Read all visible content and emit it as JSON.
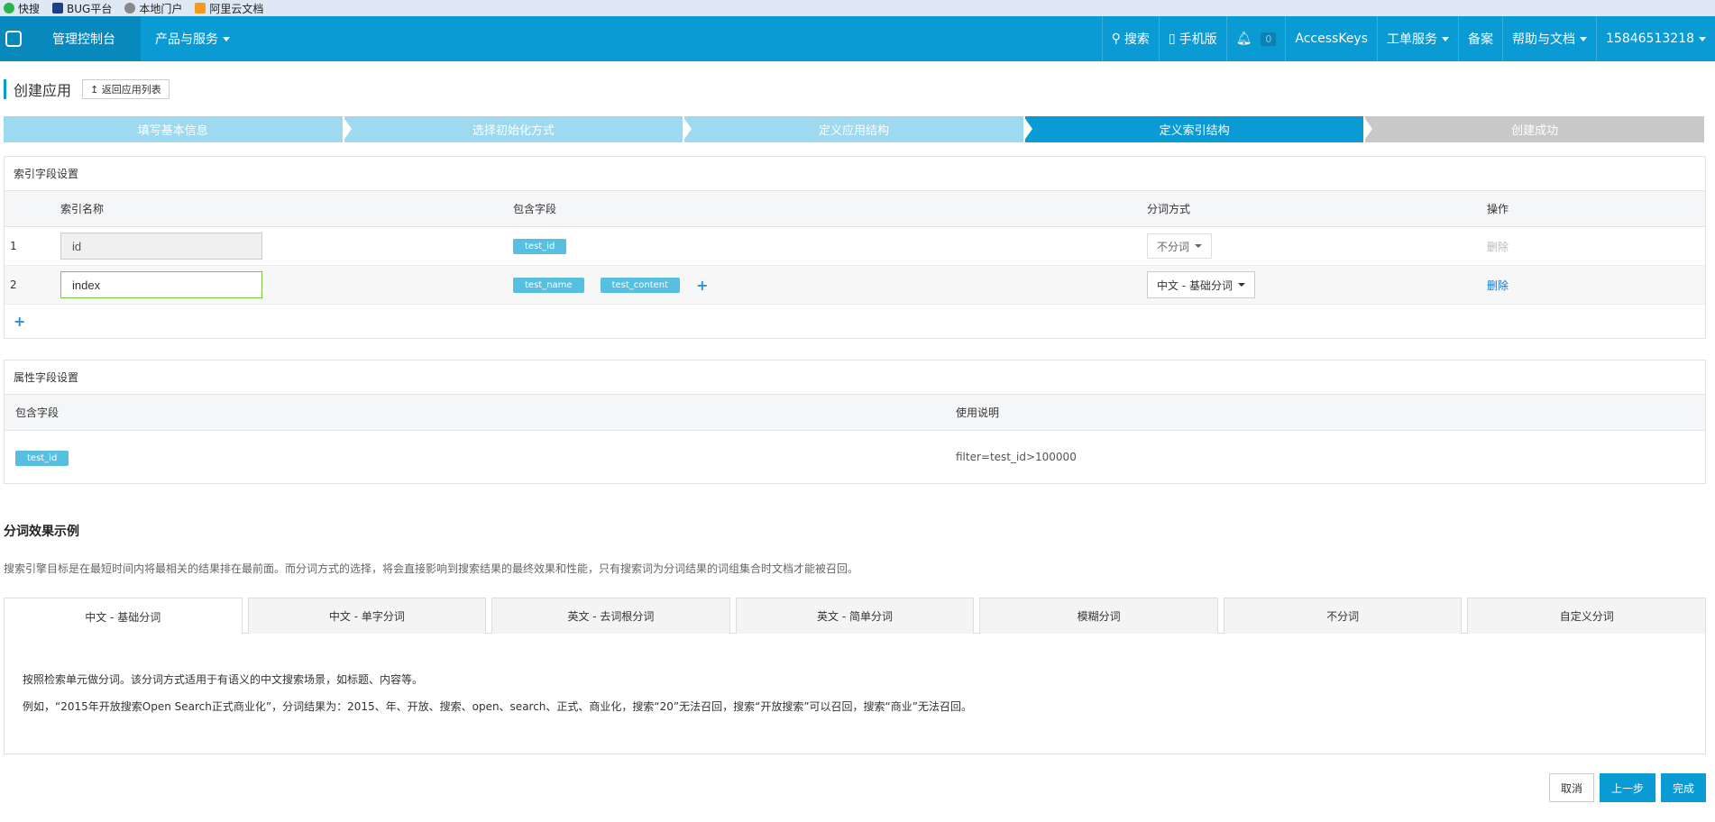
{
  "bookmarks": [
    {
      "label": "快搜",
      "icon": "kuaisou-icon",
      "color": "#2db34a"
    },
    {
      "label": "BUG平台",
      "icon": "bug-icon",
      "color": "#1d3f8a"
    },
    {
      "label": "本地门户",
      "icon": "globe-icon",
      "color": "#888888"
    },
    {
      "label": "阿里云文档",
      "icon": "aliyun-doc-icon",
      "color": "#f39a1f"
    }
  ],
  "nav": {
    "console": "管理控制台",
    "products": "产品与服务",
    "search": "搜索",
    "mobile": "手机版",
    "notify_count": "0",
    "accesskeys": "AccessKeys",
    "tickets": "工单服务",
    "record": "备案",
    "help": "帮助与文档",
    "user": "15846513218"
  },
  "page": {
    "title": "创建应用",
    "back": "返回应用列表"
  },
  "steps": [
    "填写基本信息",
    "选择初始化方式",
    "定义应用结构",
    "定义索引结构",
    "创建成功"
  ],
  "index_panel": {
    "title": "索引字段设置",
    "headers": {
      "name": "索引名称",
      "fields": "包含字段",
      "split": "分词方式",
      "op": "操作"
    },
    "rows": [
      {
        "num": "1",
        "name": "id",
        "fields": [
          "test_id"
        ],
        "split": "不分词",
        "op": "删除"
      },
      {
        "num": "2",
        "name": "index",
        "fields": [
          "test_name",
          "test_content"
        ],
        "split": "中文 - 基础分词",
        "op": "删除"
      }
    ]
  },
  "attr_panel": {
    "title": "属性字段设置",
    "headers": {
      "fields": "包含字段",
      "usage": "使用说明"
    },
    "field": "test_id",
    "usage": "filter=test_id>100000"
  },
  "examples": {
    "title": "分词效果示例",
    "desc": "搜索引擎目标是在最短时间内将最相关的结果排在最前面。而分词方式的选择，将会直接影响到搜索结果的最终效果和性能，只有搜索词为分词结果的词组集合时文档才能被召回。",
    "tabs": [
      "中文 - 基础分词",
      "中文 - 单字分词",
      "英文 - 去词根分词",
      "英文 - 简单分词",
      "模糊分词",
      "不分词",
      "自定义分词"
    ],
    "body_line1": "按照检索单元做分词。该分词方式适用于有语义的中文搜索场景，如标题、内容等。",
    "body_line2": "例如，“2015年开放搜索Open Search正式商业化”，分词结果为：2015、年、开放、搜索、open、search、正式、商业化，搜索“20”无法召回，搜索“开放搜索”可以召回，搜索“商业”无法召回。"
  },
  "footer": {
    "cancel": "取消",
    "prev": "上一步",
    "finish": "完成"
  }
}
